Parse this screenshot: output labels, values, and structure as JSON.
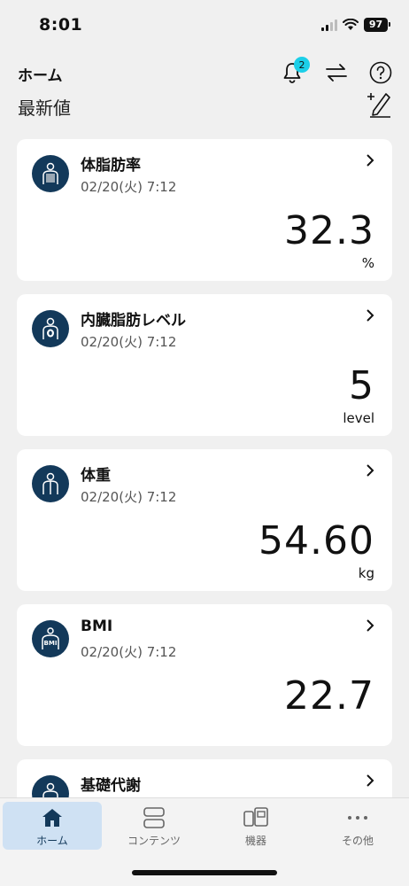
{
  "status": {
    "time": "8:01",
    "battery": "97"
  },
  "header": {
    "title": "ホーム",
    "notification_count": "2"
  },
  "section": {
    "title": "最新値"
  },
  "cards": [
    {
      "title": "体脂肪率",
      "date": "02/20(火) 7:12",
      "value": "32.3",
      "unit": "%",
      "icon": "body-fat-icon"
    },
    {
      "title": "内臓脂肪レベル",
      "date": "02/20(火) 7:12",
      "value": "5",
      "unit": "level",
      "icon": "visceral-fat-icon"
    },
    {
      "title": "体重",
      "date": "02/20(火) 7:12",
      "value": "54.60",
      "unit": "kg",
      "icon": "weight-icon"
    },
    {
      "title": "BMI",
      "date": "02/20(火) 7:12",
      "value": "22.7",
      "unit": "",
      "icon": "bmi-icon"
    },
    {
      "title": "基礎代謝",
      "date": "",
      "value": "",
      "unit": "",
      "icon": "basal-metabolism-icon"
    }
  ],
  "nav": [
    {
      "label": "ホーム",
      "icon": "home-icon",
      "active": true
    },
    {
      "label": "コンテンツ",
      "icon": "contents-icon",
      "active": false
    },
    {
      "label": "機器",
      "icon": "devices-icon",
      "active": false
    },
    {
      "label": "その他",
      "icon": "more-icon",
      "active": false
    }
  ],
  "colors": {
    "accent": "#13395a",
    "badge": "#1ccfe8",
    "background": "#f0f0f0",
    "active_nav": "#cfe1f3"
  }
}
